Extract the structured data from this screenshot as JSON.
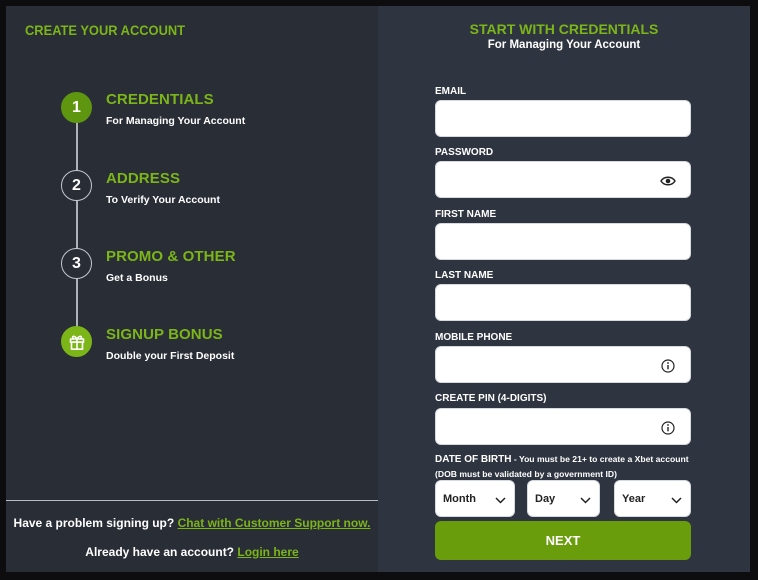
{
  "left": {
    "title": "CREATE YOUR ACCOUNT",
    "steps": [
      {
        "number": "1",
        "title": "CREDENTIALS",
        "subtitle": "For Managing Your Account",
        "active": true
      },
      {
        "number": "2",
        "title": "ADDRESS",
        "subtitle": "To Verify Your Account",
        "active": false
      },
      {
        "number": "3",
        "title": "PROMO & OTHER",
        "subtitle": "Get a Bonus",
        "active": false
      },
      {
        "number": "",
        "icon": "gift-icon",
        "title": "SIGNUP BONUS",
        "subtitle": "Double your First Deposit",
        "active": false
      }
    ],
    "help": {
      "problem_text": "Have a problem signing up?",
      "support_link": "Chat with Customer Support now.",
      "account_text": "Already have an account?",
      "login_link": "Login here"
    }
  },
  "right": {
    "title": "START WITH CREDENTIALS",
    "subtitle": "For Managing Your Account",
    "fields": {
      "email": {
        "label": "EMAIL",
        "value": ""
      },
      "password": {
        "label": "PASSWORD",
        "value": "",
        "icon": "eye-icon"
      },
      "first_name": {
        "label": "FIRST NAME",
        "value": ""
      },
      "last_name": {
        "label": "LAST NAME",
        "value": ""
      },
      "mobile_phone": {
        "label": "MOBILE PHONE",
        "value": "",
        "icon": "info-icon"
      },
      "pin": {
        "label": "CREATE PIN (4-DIGITS)",
        "value": "",
        "icon": "info-icon"
      }
    },
    "dob": {
      "label": "DATE OF BIRTH",
      "note": "- You must be 21+ to create a Xbet account (DOB must be validated by a government ID)",
      "month": "Month",
      "day": "Day",
      "year": "Year"
    },
    "next_label": "NEXT"
  },
  "colors": {
    "accent": "#7cb518",
    "button": "#6a9d0c",
    "left_bg": "#282d36",
    "right_bg": "#2f3540"
  }
}
